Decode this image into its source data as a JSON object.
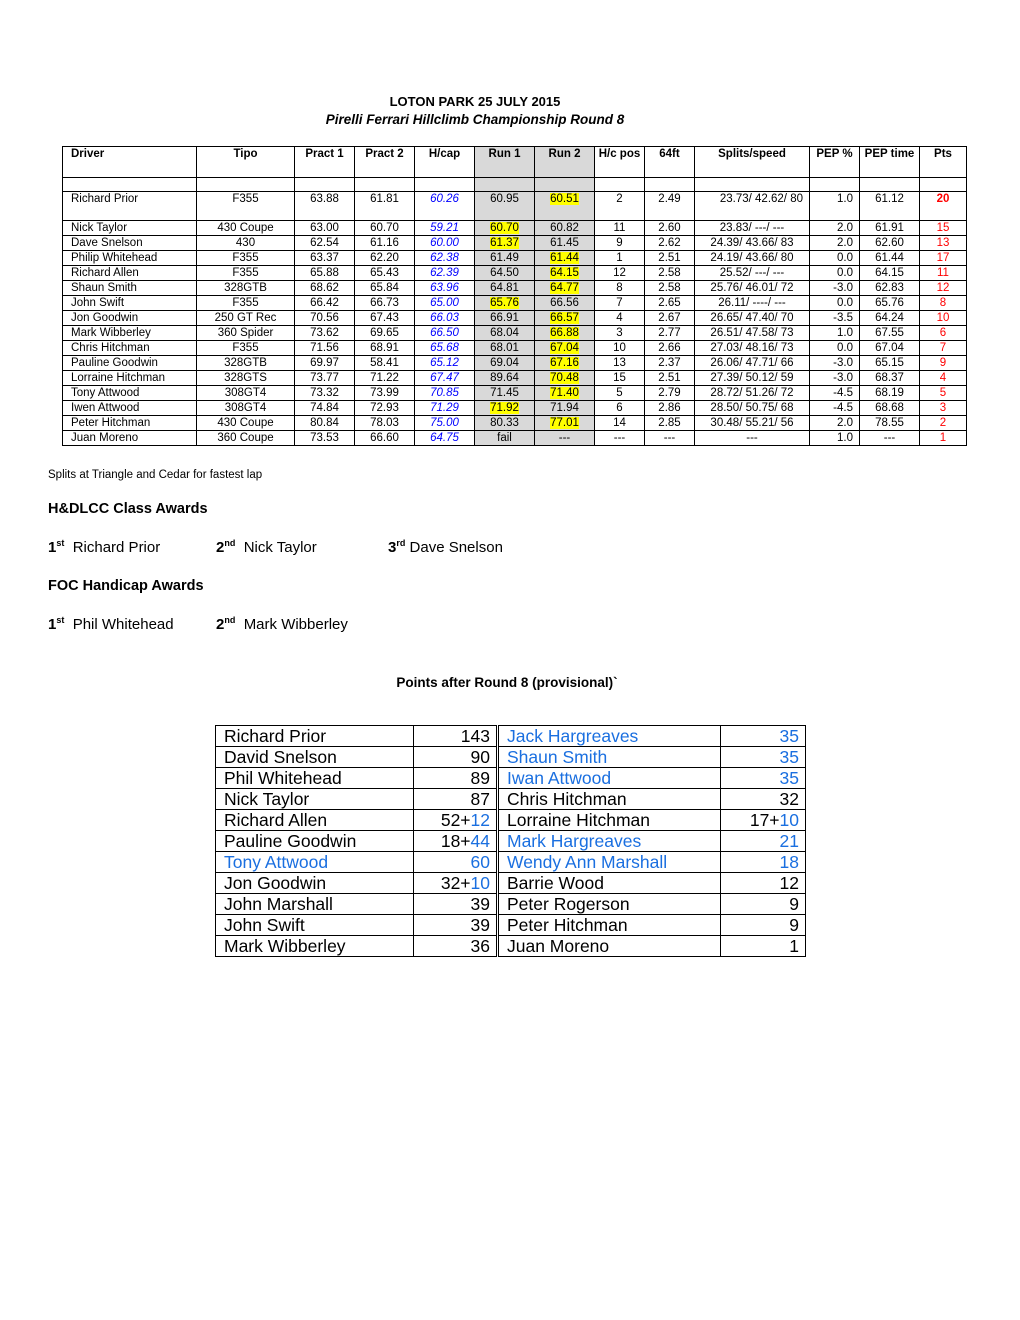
{
  "header": {
    "title": "LOTON PARK  25 JULY 2015",
    "subtitle": "Pirelli Ferrari Hillclimb Championship Round 8"
  },
  "results": {
    "columns": [
      "Driver",
      "Tipo",
      "Pract 1",
      "Pract 2",
      "H/cap",
      "Run 1",
      "Run 2",
      "H/c pos",
      "64ft",
      "Splits/speed",
      "PEP %",
      "PEP time",
      "Pts"
    ],
    "rows": [
      {
        "driver": "Richard Prior",
        "tipo": "F355",
        "pract1": "63.88",
        "pract2": "61.81",
        "hcap": "60.26",
        "run1": "60.95",
        "run2": "60.51",
        "hcpos": "2",
        "ft64": "2.49",
        "splits": "23.73/ 42.62/ 80",
        "pep_pct": "1.0",
        "pep_time": "61.12",
        "pts": "20",
        "best": "run2"
      },
      {
        "driver": "Nick Taylor",
        "tipo": "430 Coupe",
        "pract1": "63.00",
        "pract2": "60.70",
        "hcap": "59.21",
        "run1": "60.70",
        "run2": "60.82",
        "hcpos": "11",
        "ft64": "2.60",
        "splits": "23.83/ ---/ ---",
        "pep_pct": "2.0",
        "pep_time": "61.91",
        "pts": "15",
        "best": "run1"
      },
      {
        "driver": "Dave Snelson",
        "tipo": "430",
        "pract1": "62.54",
        "pract2": "61.16",
        "hcap": "60.00",
        "run1": "61.37",
        "run2": "61.45",
        "hcpos": "9",
        "ft64": "2.62",
        "splits": "24.39/ 43.66/ 83",
        "pep_pct": "2.0",
        "pep_time": "62.60",
        "pts": "13",
        "best": "run1"
      },
      {
        "driver": "Philip Whitehead",
        "tipo": "F355",
        "pract1": "63.37",
        "pract2": "62.20",
        "hcap": "62.38",
        "run1": "61.49",
        "run2": "61.44",
        "hcpos": "1",
        "ft64": "2.51",
        "splits": "24.19/ 43.66/ 80",
        "pep_pct": "0.0",
        "pep_time": "61.44",
        "pts": "17",
        "best": "run2"
      },
      {
        "driver": "Richard Allen",
        "tipo": "F355",
        "pract1": "65.88",
        "pract2": "65.43",
        "hcap": "62.39",
        "run1": "64.50",
        "run2": "64.15",
        "hcpos": "12",
        "ft64": "2.58",
        "splits": "25.52/ ---/ ---",
        "pep_pct": "0.0",
        "pep_time": "64.15",
        "pts": "11",
        "best": "run2"
      },
      {
        "driver": "Shaun Smith",
        "tipo": "328GTB",
        "pract1": "68.62",
        "pract2": "65.84",
        "hcap": "63.96",
        "run1": "64.81",
        "run2": "64.77",
        "hcpos": "8",
        "ft64": "2.58",
        "splits": "25.76/ 46.01/ 72",
        "pep_pct": "-3.0",
        "pep_time": "62.83",
        "pts": "12",
        "best": "run2"
      },
      {
        "driver": "John Swift",
        "tipo": "F355",
        "pract1": "66.42",
        "pract2": "66.73",
        "hcap": "65.00",
        "run1": "65.76",
        "run2": "66.56",
        "hcpos": "7",
        "ft64": "2.65",
        "splits": "26.11/ ----/ ---",
        "pep_pct": "0.0",
        "pep_time": "65.76",
        "pts": "8",
        "best": "run1"
      },
      {
        "driver": "Jon Goodwin",
        "tipo": "250 GT Rec",
        "pract1": "70.56",
        "pract2": "67.43",
        "hcap": "66.03",
        "run1": "66.91",
        "run2": "66.57",
        "hcpos": "4",
        "ft64": "2.67",
        "splits": "26.65/ 47.40/ 70",
        "pep_pct": "-3.5",
        "pep_time": "64.24",
        "pts": "10",
        "best": "run2"
      },
      {
        "driver": "Mark Wibberley",
        "tipo": "360 Spider",
        "pract1": "73.62",
        "pract2": "69.65",
        "hcap": "66.50",
        "run1": "68.04",
        "run2": "66.88",
        "hcpos": "3",
        "ft64": "2.77",
        "splits": "26.51/ 47.58/ 73",
        "pep_pct": "1.0",
        "pep_time": "67.55",
        "pts": "6",
        "best": "run2"
      },
      {
        "driver": "Chris Hitchman",
        "tipo": "F355",
        "pract1": "71.56",
        "pract2": "68.91",
        "hcap": "65.68",
        "run1": "68.01",
        "run2": "67.04",
        "hcpos": "10",
        "ft64": "2.66",
        "splits": "27.03/ 48.16/ 73",
        "pep_pct": "0.0",
        "pep_time": "67.04",
        "pts": "7",
        "best": "run2"
      },
      {
        "driver": "Pauline Goodwin",
        "tipo": "328GTB",
        "pract1": "69.97",
        "pract2": "58.41",
        "hcap": "65.12",
        "run1": "69.04",
        "run2": "67.16",
        "hcpos": "13",
        "ft64": "2.37",
        "splits": "26.06/ 47.71/ 66",
        "pep_pct": "-3.0",
        "pep_time": "65.15",
        "pts": "9",
        "best": "run2"
      },
      {
        "driver": "Lorraine Hitchman",
        "tipo": "328GTS",
        "pract1": "73.77",
        "pract2": "71.22",
        "hcap": "67.47",
        "run1": "89.64",
        "run2": "70.48",
        "hcpos": "15",
        "ft64": "2.51",
        "splits": "27.39/ 50.12/ 59",
        "pep_pct": "-3.0",
        "pep_time": "68.37",
        "pts": "4",
        "best": "run2"
      },
      {
        "driver": "Tony Attwood",
        "tipo": "308GT4",
        "pract1": "73.32",
        "pract2": "73.99",
        "hcap": "70.85",
        "run1": "71.45",
        "run2": "71.40",
        "hcpos": "5",
        "ft64": "2.79",
        "splits": "28.72/ 51.26/ 72",
        "pep_pct": "-4.5",
        "pep_time": "68.19",
        "pts": "5",
        "best": "run2"
      },
      {
        "driver": "Iwen Attwood",
        "tipo": "308GT4",
        "pract1": "74.84",
        "pract2": "72.93",
        "hcap": "71.29",
        "run1": "71.92",
        "run2": "71.94",
        "hcpos": "6",
        "ft64": "2.86",
        "splits": "28.50/ 50.75/ 68",
        "pep_pct": "-4.5",
        "pep_time": "68.68",
        "pts": "3",
        "best": "run1"
      },
      {
        "driver": "Peter Hitchman",
        "tipo": "430 Coupe",
        "pract1": "80.84",
        "pract2": "78.03",
        "hcap": "75.00",
        "run1": "80.33",
        "run2": "77.01",
        "hcpos": "14",
        "ft64": "2.85",
        "splits": "30.48/ 55.21/ 56",
        "pep_pct": "2.0",
        "pep_time": "78.55",
        "pts": "2",
        "best": "run2"
      },
      {
        "driver": "Juan Moreno",
        "tipo": "360 Coupe",
        "pract1": "73.53",
        "pract2": "66.60",
        "hcap": "64.75",
        "run1": "fail",
        "run2": "---",
        "hcpos": "---",
        "ft64": "---",
        "splits": "---",
        "pep_pct": "1.0",
        "pep_time": "---",
        "pts": "1",
        "best": ""
      }
    ],
    "note": "Splits at Triangle and Cedar for fastest lap"
  },
  "class_awards": {
    "heading": "H&DLCC Class Awards",
    "places": [
      {
        "place": "1",
        "suffix": "st",
        "name": "Richard Prior"
      },
      {
        "place": "2",
        "suffix": "nd",
        "name": "Nick Taylor"
      },
      {
        "place": "3",
        "suffix": "rd",
        "name": "Dave Snelson"
      }
    ]
  },
  "handicap_awards": {
    "heading": "FOC Handicap Awards",
    "places": [
      {
        "place": "1",
        "suffix": "st",
        "name": "Phil Whitehead"
      },
      {
        "place": "2",
        "suffix": "nd",
        "name": "Mark Wibberley"
      }
    ]
  },
  "points": {
    "heading": "Points after Round 8 (provisional)`",
    "rows": [
      {
        "name": "Richard Prior",
        "base": "143",
        "bonus": "",
        "name_blue": false,
        "name2": "Jack Hargreaves",
        "base2": "35",
        "bonus2": "",
        "name2_blue": true
      },
      {
        "name": "David Snelson",
        "base": "90",
        "bonus": "",
        "name_blue": false,
        "name2": "Shaun Smith",
        "base2": "35",
        "bonus2": "",
        "name2_blue": true
      },
      {
        "name": "Phil Whitehead",
        "base": "89",
        "bonus": "",
        "name_blue": false,
        "name2": "Iwan Attwood",
        "base2": "35",
        "bonus2": "",
        "name2_blue": true
      },
      {
        "name": "Nick Taylor",
        "base": "87",
        "bonus": "",
        "name_blue": false,
        "name2": "Chris Hitchman",
        "base2": "32",
        "bonus2": "",
        "name2_blue": false
      },
      {
        "name": "Richard Allen",
        "base": "52+",
        "bonus": "12",
        "name_blue": false,
        "name2": "Lorraine Hitchman",
        "base2": "17+",
        "bonus2": "10",
        "name2_blue": false
      },
      {
        "name": "Pauline Goodwin",
        "base": "18+",
        "bonus": "44",
        "name_blue": false,
        "name2": "Mark Hargreaves",
        "base2": "21",
        "bonus2": "",
        "name2_blue": true
      },
      {
        "name": "Tony Attwood",
        "base": "60",
        "bonus": "",
        "name_blue": true,
        "name2": "Wendy Ann Marshall",
        "base2": "18",
        "bonus2": "",
        "name2_blue": true
      },
      {
        "name": "Jon Goodwin",
        "base": "32+",
        "bonus": "10",
        "name_blue": false,
        "name2": "Barrie Wood",
        "base2": "12",
        "bonus2": "",
        "name2_blue": false
      },
      {
        "name": "John  Marshall",
        "base": "39",
        "bonus": "",
        "name_blue": false,
        "name2": "Peter Rogerson",
        "base2": "9",
        "bonus2": "",
        "name2_blue": false
      },
      {
        "name": "John Swift",
        "base": "39",
        "bonus": "",
        "name_blue": false,
        "name2": "Peter Hitchman",
        "base2": "9",
        "bonus2": "",
        "name2_blue": false
      },
      {
        "name": "Mark Wibberley",
        "base": "36",
        "bonus": "",
        "name_blue": false,
        "name2": "Juan Moreno",
        "base2": "1",
        "bonus2": "",
        "name2_blue": false
      }
    ]
  },
  "colors": {
    "handicap_text": "#0000ff",
    "points_text": "#ff0000",
    "highlight": "#ffff00",
    "run_shade": "#d9d9d9",
    "points_blue": "#1a6fe0"
  }
}
